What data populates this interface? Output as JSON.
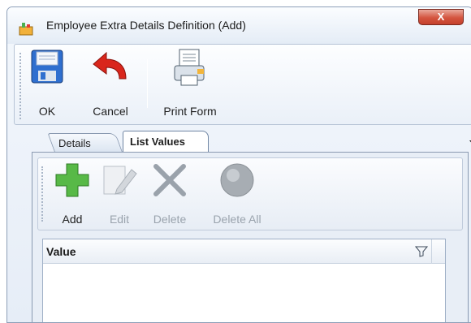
{
  "window": {
    "title": "Employee Extra Details Definition (Add)",
    "close_label": "X"
  },
  "toolbar": {
    "ok_label": "OK",
    "cancel_label": "Cancel",
    "print_form_label": "Print Form"
  },
  "tabs": [
    {
      "label": "Details",
      "selected": false
    },
    {
      "label": "List Values",
      "selected": true
    }
  ],
  "list_values_toolbar": {
    "add_label": "Add",
    "edit_label": "Edit",
    "delete_label": "Delete",
    "delete_all_label": "Delete All"
  },
  "grid": {
    "columns": [
      {
        "label": "Value"
      }
    ],
    "rows": []
  }
}
